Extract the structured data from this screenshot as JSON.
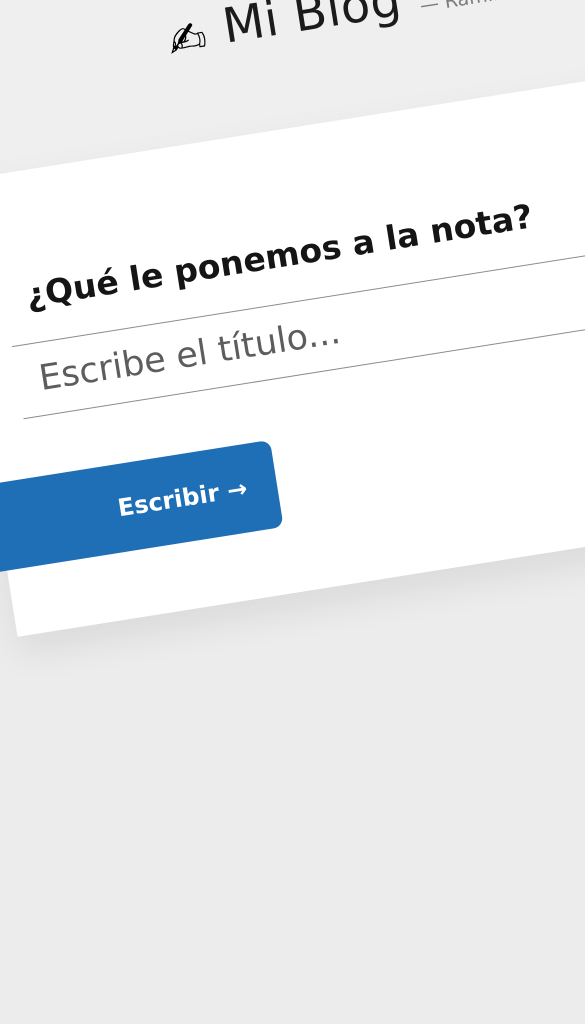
{
  "header": {
    "icon": "✍",
    "icon_name": "writing-hand-icon",
    "title": "Mi Blog",
    "author": "— Ramiro Lóizaga"
  },
  "form": {
    "question": "¿Qué le ponemos a la nota?",
    "title_placeholder": "Escribe el título...",
    "submit_label": "Escribir →"
  },
  "colors": {
    "accent": "#1f6fb6",
    "header_bg": "#efeff0",
    "page_bg": "#ececed",
    "card_bg": "#ffffff"
  }
}
